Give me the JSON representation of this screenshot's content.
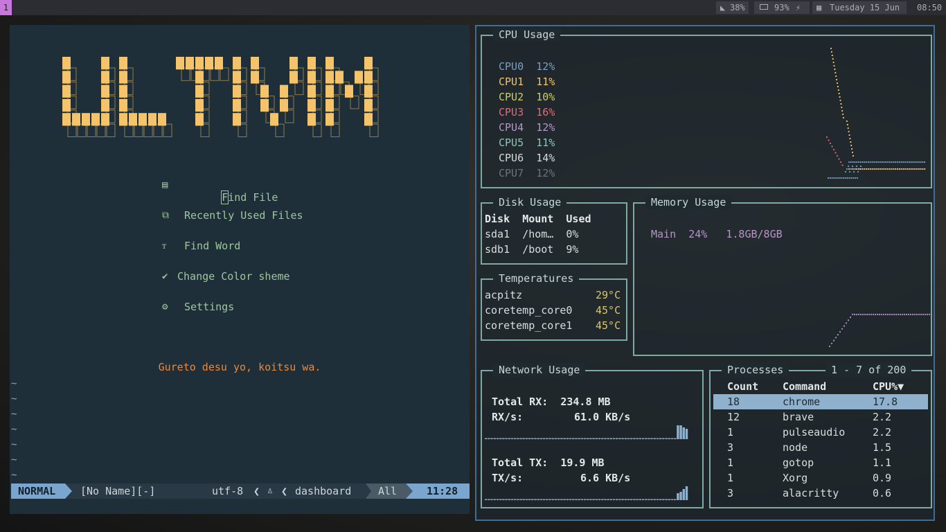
{
  "topbar": {
    "workspace": "1",
    "volume": "38%",
    "battery": "93%",
    "date": "Tuesday 15 Jun",
    "time": "08:50"
  },
  "nvim": {
    "logo_text": "ULTIVIM",
    "menu": [
      {
        "icon": "file-icon",
        "label": "Find File",
        "highlight": "F",
        "rest": "ind File"
      },
      {
        "icon": "recent-files-icon",
        "label": "Recently Used Files"
      },
      {
        "icon": "text-icon",
        "label": "Find Word"
      },
      {
        "icon": "brush-icon",
        "label": "Change Color sheme"
      },
      {
        "icon": "gear-icon",
        "label": "Settings"
      }
    ],
    "quote": "Gureto desu yo, koitsu wa.",
    "tilde": "~",
    "status": {
      "mode": "NORMAL",
      "buffer": "[No Name][-]",
      "encoding": "utf-8",
      "filetype": "dashboard",
      "scroll": "All",
      "position": "11:28"
    }
  },
  "gotop": {
    "cpu": {
      "title": "CPU Usage",
      "cores": [
        {
          "name": "CPU0",
          "value": "12%",
          "color": "#7a9ec2"
        },
        {
          "name": "CPU1",
          "value": "11%",
          "color": "#f2c46d"
        },
        {
          "name": "CPU2",
          "value": "10%",
          "color": "#c9cf63"
        },
        {
          "name": "CPU3",
          "value": "16%",
          "color": "#e06c75"
        },
        {
          "name": "CPU4",
          "value": "12%",
          "color": "#b795c9"
        },
        {
          "name": "CPU5",
          "value": "11%",
          "color": "#8fc4bd"
        },
        {
          "name": "CPU6",
          "value": "14%",
          "color": "#d7dbd8"
        },
        {
          "name": "CPU7",
          "value": "12%",
          "color": "#6d7478"
        }
      ]
    },
    "disk": {
      "title": "Disk Usage",
      "headers": [
        "Disk",
        "Mount",
        "Used"
      ],
      "rows": [
        [
          "sda1",
          "/hom…",
          "0%"
        ],
        [
          "sdb1",
          "/boot",
          "9%"
        ]
      ]
    },
    "memory": {
      "title": "Memory Usage",
      "name": "Main",
      "percent": "24%",
      "amount": "1.8GB/8GB"
    },
    "temps": {
      "title": "Temperatures",
      "rows": [
        [
          "acpitz",
          "29°C"
        ],
        [
          "coretemp_core0",
          "45°C"
        ],
        [
          "coretemp_core1",
          "45°C"
        ]
      ]
    },
    "network": {
      "title": "Network Usage",
      "total_rx_label": "Total RX:",
      "total_rx": "234.8 MB",
      "rx_rate_label": "RX/s:",
      "rx_rate": "61.0 KB/s",
      "total_tx_label": "Total TX:",
      "total_tx": "19.9 MB",
      "tx_rate_label": "TX/s:",
      "tx_rate": "6.6 KB/s"
    },
    "processes": {
      "title": "Processes",
      "range": "1 - 7 of 200",
      "headers": [
        "Count",
        "Command",
        "CPU%▼"
      ],
      "rows": [
        [
          "18",
          "chrome",
          "17.8"
        ],
        [
          "12",
          "brave",
          "2.2"
        ],
        [
          "1",
          "pulseaudio",
          "2.2"
        ],
        [
          "3",
          "node",
          "1.5"
        ],
        [
          "1",
          "gotop",
          "1.1"
        ],
        [
          "1",
          "Xorg",
          "0.9"
        ],
        [
          "3",
          "alacritty",
          "0.6"
        ]
      ]
    }
  }
}
